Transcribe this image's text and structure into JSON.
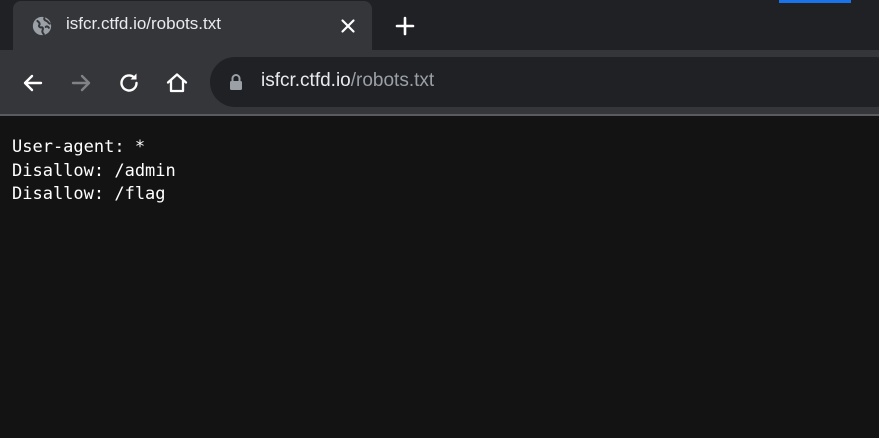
{
  "tab": {
    "title": "isfcr.ctfd.io/robots.txt",
    "favicon": "globe-icon",
    "close_icon": "close-icon"
  },
  "new_tab_icon": "plus-icon",
  "toolbar": {
    "back_icon": "arrow-left-icon",
    "forward_icon": "arrow-right-icon",
    "reload_icon": "reload-icon",
    "home_icon": "home-icon"
  },
  "omnibox": {
    "lock_icon": "lock-icon",
    "host": "isfcr.ctfd.io",
    "path": "/robots.txt"
  },
  "page": {
    "lines": [
      "User-agent: *",
      "Disallow: /admin",
      "Disallow: /flag"
    ]
  },
  "colors": {
    "tabstrip_bg": "#202124",
    "tab_active_bg": "#35363a",
    "toolbar_bg": "#35363a",
    "omnibox_bg": "#202124",
    "page_bg": "#131313",
    "text_primary": "#e8eaed",
    "text_secondary": "#9aa0a6",
    "accent": "#1a73e8"
  }
}
